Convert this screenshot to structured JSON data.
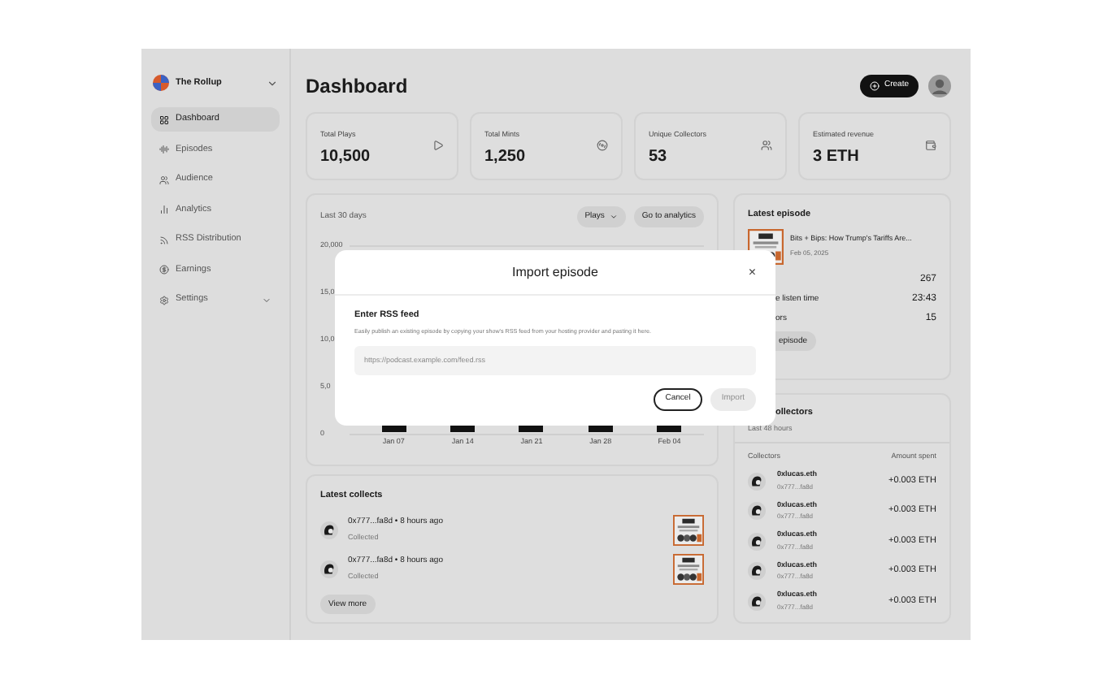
{
  "sidebar": {
    "brand": "The Rollup",
    "items": [
      {
        "label": "Dashboard",
        "selected": true,
        "expandable": false
      },
      {
        "label": "Episodes",
        "selected": false,
        "expandable": false
      },
      {
        "label": "Audience",
        "selected": false,
        "expandable": false
      },
      {
        "label": "Analytics",
        "selected": false,
        "expandable": false
      },
      {
        "label": "RSS Distribution",
        "selected": false,
        "expandable": false
      },
      {
        "label": "Earnings",
        "selected": false,
        "expandable": false
      },
      {
        "label": "Settings",
        "selected": false,
        "expandable": true
      }
    ]
  },
  "header": {
    "title": "Dashboard",
    "create_button": "Create"
  },
  "stats": [
    {
      "label": "Total Plays",
      "value": "10,500"
    },
    {
      "label": "Total Mints",
      "value": "1,250"
    },
    {
      "label": "Unique Collectors",
      "value": "53"
    },
    {
      "label": "Estimated revenue",
      "value": "3 ETH"
    }
  ],
  "chart_card": {
    "range": "Last 30 days",
    "metric_dropdown": "Plays",
    "analytics_button": "Go to analytics",
    "y_labels": [
      "20,000",
      "15,0",
      "10,0",
      "5,0",
      "0"
    ],
    "x_labels": [
      "Jan 07",
      "Jan 14",
      "Jan 21",
      "Jan 28",
      "Feb 04"
    ]
  },
  "latest_collects": {
    "title": "Latest collects",
    "rows": [
      {
        "address": "0x777...fa8d",
        "separator": "•",
        "time": "8 hours ago",
        "status": "Collected"
      },
      {
        "address": "0x777...fa8d",
        "separator": "•",
        "time": "8 hours ago",
        "status": "Collected"
      }
    ],
    "view_more": "View more"
  },
  "latest_episode": {
    "title": "Latest episode",
    "episode_title": "Bits + Bips: How Trump's Tariffs Are...",
    "date": "Feb 05, 2025",
    "stats": [
      {
        "value": "267"
      },
      {
        "label": "e listen time",
        "value": "23:43"
      },
      {
        "label": "ors",
        "value": "15"
      }
    ],
    "button": "episode"
  },
  "top_collectors": {
    "title": "ollectors",
    "subtitle": "Last 48 hours",
    "columns": [
      "Collectors",
      "Amount spent"
    ],
    "rows": [
      {
        "name": "0xlucas.eth",
        "address": "0x777...fa8d",
        "amount": "+0.003 ETH"
      },
      {
        "name": "0xlucas.eth",
        "address": "0x777...fa8d",
        "amount": "+0.003 ETH"
      },
      {
        "name": "0xlucas.eth",
        "address": "0x777...fa8d",
        "amount": "+0.003 ETH"
      },
      {
        "name": "0xlucas.eth",
        "address": "0x777...fa8d",
        "amount": "+0.003 ETH"
      },
      {
        "name": "0xlucas.eth",
        "address": "0x777...fa8d",
        "amount": "+0.003 ETH"
      }
    ]
  },
  "modal": {
    "title": "Import episode",
    "close": "×",
    "section_title": "Enter RSS feed",
    "description": "Easily publish an existing episode by copying your show's RSS feed from your hosting provider and pasting it here.",
    "input_placeholder": "https://podcast.example.com/feed.rss",
    "cancel": "Cancel",
    "import": "Import",
    "import_disabled": true
  }
}
